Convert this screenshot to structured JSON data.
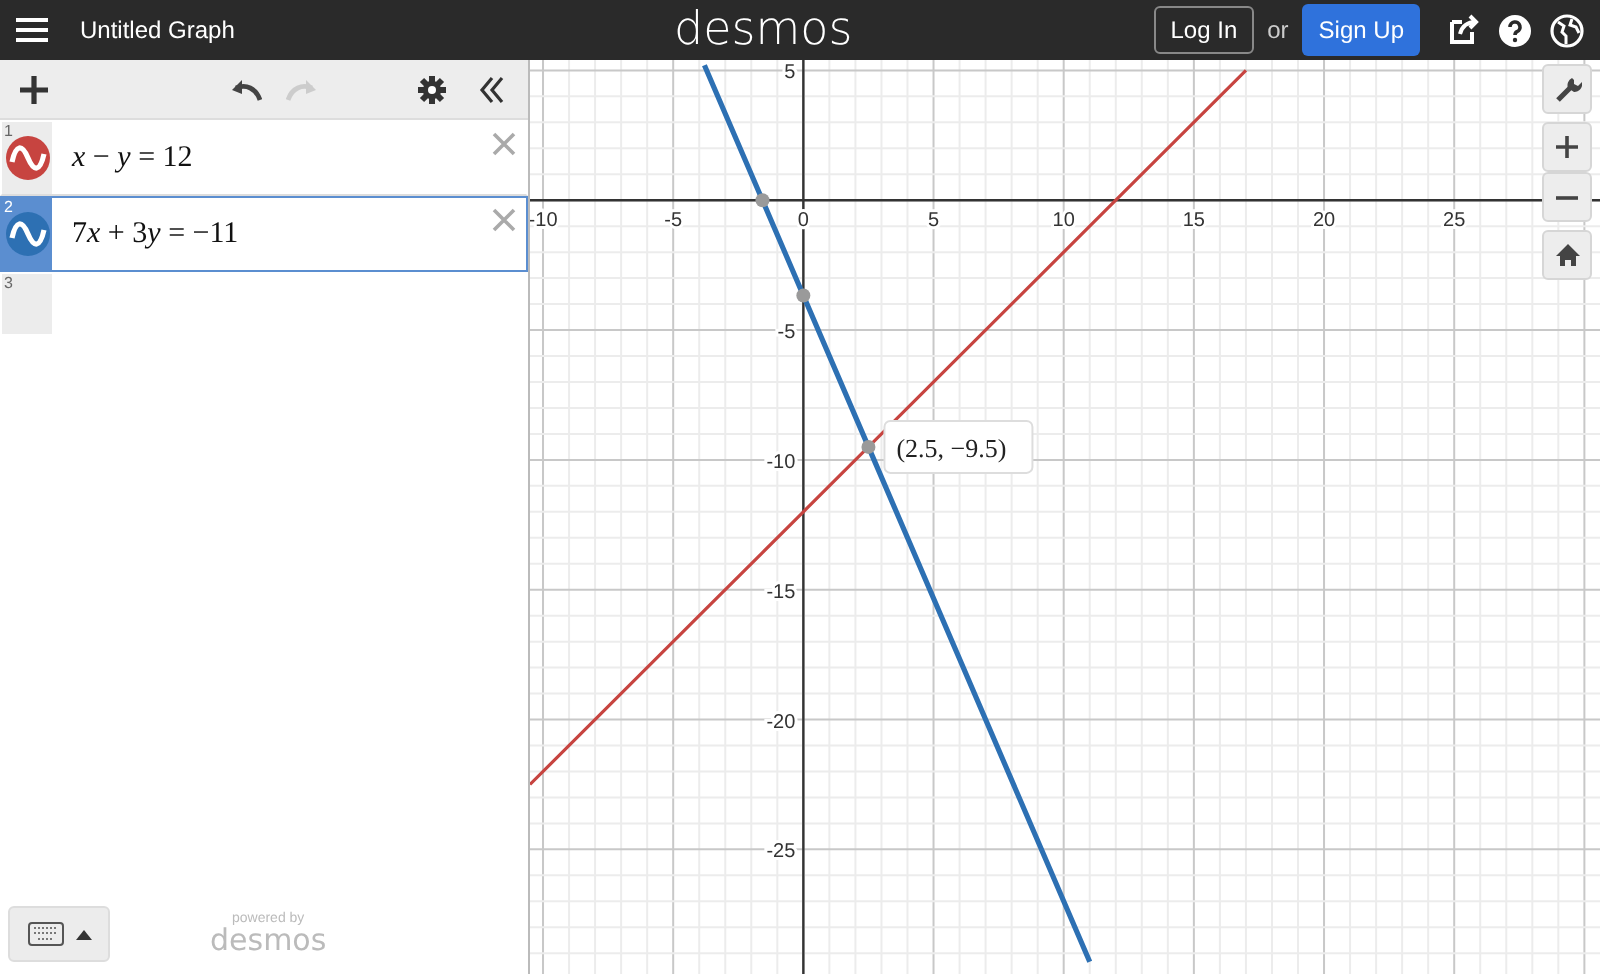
{
  "top_bar": {
    "title": "Untitled Graph",
    "logo": "desmos",
    "login": "Log In",
    "or": "or",
    "signup": "Sign Up"
  },
  "toolbar": {
    "undo_disabled": false,
    "redo_disabled": true
  },
  "expressions": [
    {
      "number": "1",
      "latex": "x − y = 12",
      "color": "#c74440",
      "selected": false
    },
    {
      "number": "2",
      "latex": "7x + 3y = −11",
      "color": "#2d70b3",
      "selected": true
    },
    {
      "number": "3",
      "selected": false
    }
  ],
  "footer": {
    "powered_by": "powered by",
    "brand": "desmos"
  },
  "graph": {
    "chart_data": {
      "type": "line",
      "x": [
        -10.5,
        -3.8,
        -1.57,
        0,
        2.5,
        11,
        17
      ],
      "xlim": [
        -10.5,
        30.6
      ],
      "ylim": [
        -29.8,
        5.4
      ],
      "xticks": [
        -10,
        -5,
        0,
        5,
        10,
        15,
        20,
        25
      ],
      "yticks": [
        5,
        -5,
        -10,
        -15,
        -20,
        -25
      ],
      "series": [
        {
          "color": "#c74440",
          "values": [
            -22.5,
            -15.8,
            -13.57,
            -12,
            -9.5,
            -1,
            5
          ]
        },
        {
          "color": "#2d70b3",
          "values": [
            null,
            5.2,
            0,
            -3.67,
            -9.5,
            -29.33,
            null
          ]
        }
      ],
      "grid": true,
      "annotations": [
        {
          "x": 2.5,
          "y": -9.5,
          "text": "(2.5, −9.5)"
        }
      ]
    }
  }
}
